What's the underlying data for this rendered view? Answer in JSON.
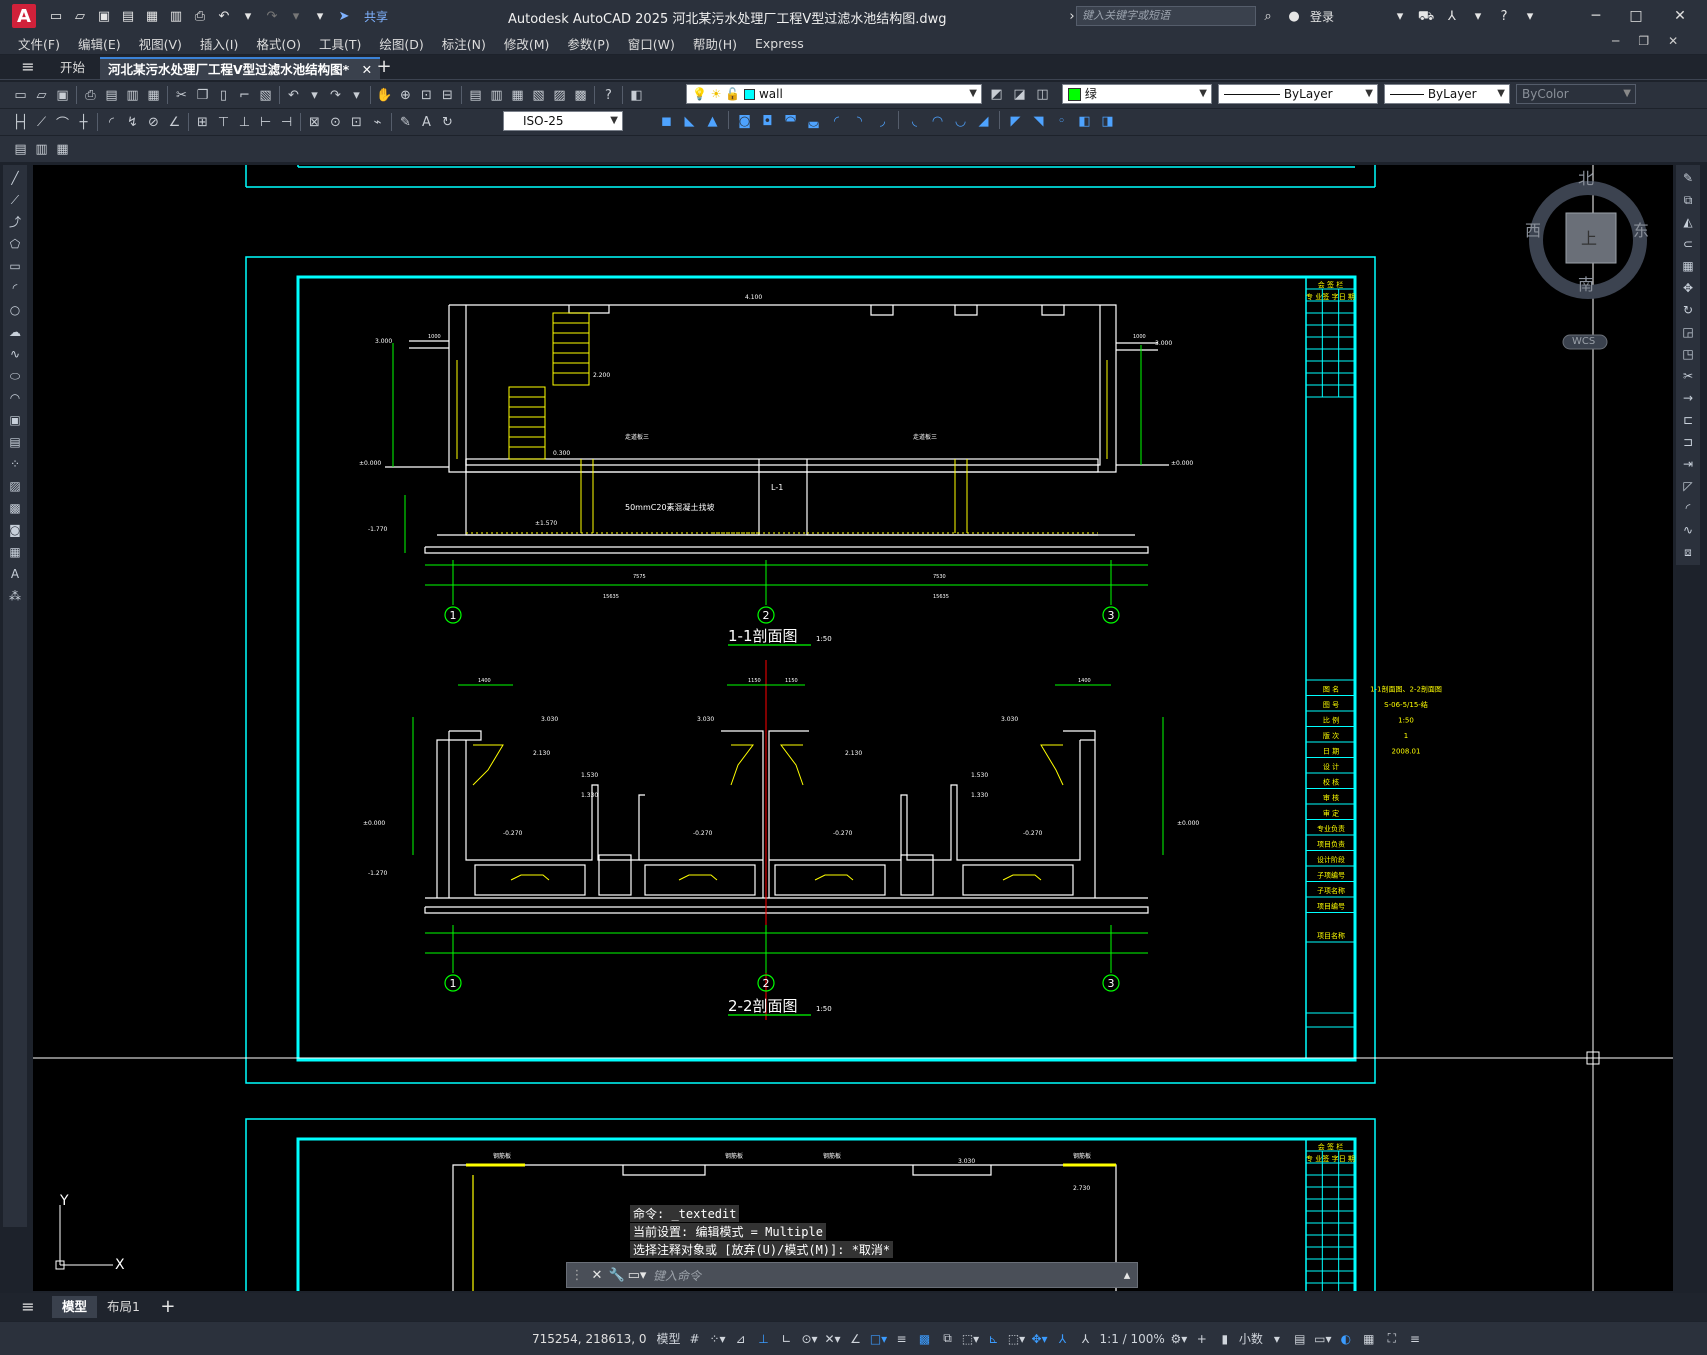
{
  "app": {
    "logo": "A",
    "title": "Autodesk AutoCAD 2025    河北某污水处理厂工程V型过滤水池结构图.dwg",
    "share": "共享",
    "search_placeholder": "键入关键字或短语",
    "login": "登录"
  },
  "menu": [
    "文件(F)",
    "编辑(E)",
    "视图(V)",
    "插入(I)",
    "格式(O)",
    "工具(T)",
    "绘图(D)",
    "标注(N)",
    "修改(M)",
    "参数(P)",
    "窗口(W)",
    "帮助(H)",
    "Express"
  ],
  "tabs": {
    "start": "开始",
    "drawing": "河北某污水处理厂工程V型过滤水池结构图*"
  },
  "properties": {
    "layer": "wall",
    "color": "绿",
    "linetype": "ByLayer",
    "lineweight": "ByLayer",
    "plotstyle": "ByColor",
    "dimstyle": "ISO-25",
    "layer_color": "#00ffff",
    "color_swatch": "#00ff00"
  },
  "viewcube": {
    "north": "北",
    "south": "南",
    "east": "东",
    "west": "西",
    "top": "上",
    "wcs": "WCS"
  },
  "ucs": {
    "x": "X",
    "y": "Y"
  },
  "drawing": {
    "section1_title": "1-1剖面图",
    "section2_title": "2-2剖面图",
    "scale": "1:50",
    "axes": [
      "1",
      "2",
      "3"
    ],
    "label_l1": "L-1",
    "label_concrete": "50mmC20素混凝土找坡",
    "elev_top": "4.100",
    "elev_3000": "3.000",
    "elev_zero": "±0.000",
    "elev_neg": "-1.770",
    "elev_2200": "2.200",
    "elev_0300": "0.300",
    "elev_1570": "±1.570",
    "elev_3030": "3.030",
    "elev_2130": "2.130",
    "elev_1530": "1.530",
    "elev_1330": "1.330",
    "elev_neg2": "-1.270",
    "elev_0270": "-0.270",
    "dim_1000": "1000",
    "dim_1400": "1400",
    "dim_1150": "1150",
    "dim_7575": "7575",
    "dim_7530": "7530",
    "dim_15635": "15635",
    "note_label": "走道板三"
  },
  "titleblock": {
    "header": "会 签 栏",
    "cols": [
      "专 业",
      "签 字",
      "日 期"
    ],
    "rows": [
      [
        "图    名",
        "1-1剖面图、2-2剖面图"
      ],
      [
        "图    号",
        "S-06-5/15-结"
      ],
      [
        "比    例",
        "1:50"
      ],
      [
        "版    次",
        "1"
      ],
      [
        "日    期",
        "2008.01"
      ],
      [
        "设    计",
        ""
      ],
      [
        "校    核",
        ""
      ],
      [
        "审    核",
        ""
      ],
      [
        "审    定",
        ""
      ],
      [
        "专业负责",
        ""
      ],
      [
        "项目负责",
        ""
      ],
      [
        "设计阶段",
        ""
      ],
      [
        "子项编号",
        ""
      ],
      [
        "子项名称",
        ""
      ],
      [
        "项目编号",
        ""
      ],
      [
        "项目名称",
        ""
      ]
    ]
  },
  "bottom_labels": [
    "钢筋板",
    "钢筋板",
    "钢筋板",
    "钢筋板",
    "3.030",
    "2.730",
    "1.530"
  ],
  "command": {
    "lines": [
      "命令: _textedit",
      "当前设置: 编辑模式 = Multiple",
      "选择注释对象或 [放弃(U)/模式(M)]: *取消*"
    ],
    "placeholder": "键入命令"
  },
  "layouts": [
    "模型",
    "布局1"
  ],
  "status": {
    "coords": "715254, 218613, 0",
    "model": "模型",
    "scale": "1:1 / 100%",
    "units": "小数"
  }
}
